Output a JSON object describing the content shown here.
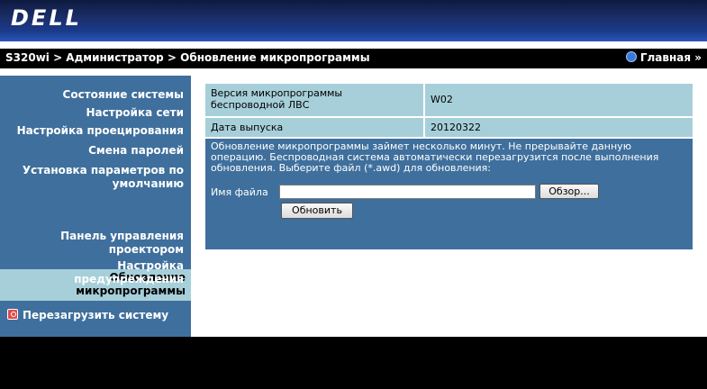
{
  "header": {
    "logo": "DELL"
  },
  "nav": {
    "breadcrumb": "S320wi > Администратор > Обновление микропрограммы",
    "home_label": "Главная »"
  },
  "sidebar": {
    "items": [
      {
        "label": "Состояние системы"
      },
      {
        "label": "Настройка сети"
      },
      {
        "label": "Настройка проецирования"
      },
      {
        "label": "Смена паролей"
      },
      {
        "label_line1": "Установка параметров по",
        "label_line2": "умолчанию"
      },
      {
        "label_line1": "Обновление",
        "label_line2": "микропрограммы",
        "active": true
      },
      {
        "label_line1": "Панель управления",
        "label_line2": "проектором"
      },
      {
        "label_line1": "Настройка",
        "label_line2": "предупреждения"
      }
    ],
    "reboot_label": "Перезагрузить систему"
  },
  "info": {
    "version_label_line1": "Версия микропрограммы",
    "version_label_line2": "беспроводной ЛВС",
    "version_value": "W02",
    "date_label": "Дата выпуска",
    "date_value": "20120322"
  },
  "update": {
    "description_line1": "Обновление микропрограммы займет несколько минут. Не прерывайте данную",
    "description_line2": "операцию. Беспроводная система автоматически перезагрузится после выполнения",
    "description_line3": "обновления. Выберите файл (*.awd) для обновления:",
    "file_label": "Имя файла",
    "file_value": "",
    "browse_label": "Обзор...",
    "update_label": "Обновить"
  },
  "colors": {
    "sidebar_bg": "#3f6f9c",
    "active_bg": "#a7cfd9",
    "cell_bg": "#a7cfd9",
    "nav_bg": "#000000",
    "header_blue": "#1b2f6b"
  }
}
